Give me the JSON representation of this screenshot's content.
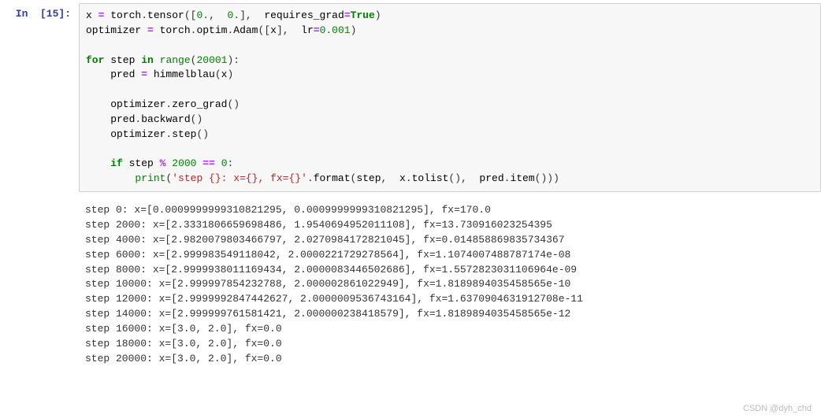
{
  "cell": {
    "prompt": "In  [15]:",
    "code_tokens": [
      {
        "t": "x ",
        "c": "nm"
      },
      {
        "t": "=",
        "c": "op"
      },
      {
        "t": " torch",
        "c": "nm"
      },
      {
        "t": ".",
        "c": "pu"
      },
      {
        "t": "tensor",
        "c": "nm"
      },
      {
        "t": "(",
        "c": "pu"
      },
      {
        "t": "[",
        "c": "pu"
      },
      {
        "t": "0.",
        "c": "num"
      },
      {
        "t": ", ",
        "c": "pu"
      },
      {
        "t": " 0.",
        "c": "num"
      },
      {
        "t": "]",
        "c": "pu"
      },
      {
        "t": ", ",
        "c": "pu"
      },
      {
        "t": " requires_grad",
        "c": "nm"
      },
      {
        "t": "=",
        "c": "op"
      },
      {
        "t": "True",
        "c": "kw"
      },
      {
        "t": ")",
        "c": "pu"
      },
      {
        "t": "\n",
        "c": "pu"
      },
      {
        "t": "optimizer ",
        "c": "nm"
      },
      {
        "t": "=",
        "c": "op"
      },
      {
        "t": " torch",
        "c": "nm"
      },
      {
        "t": ".",
        "c": "pu"
      },
      {
        "t": "optim",
        "c": "nm"
      },
      {
        "t": ".",
        "c": "pu"
      },
      {
        "t": "Adam",
        "c": "nm"
      },
      {
        "t": "(",
        "c": "pu"
      },
      {
        "t": "[",
        "c": "pu"
      },
      {
        "t": "x",
        "c": "nm"
      },
      {
        "t": "]",
        "c": "pu"
      },
      {
        "t": ", ",
        "c": "pu"
      },
      {
        "t": " lr",
        "c": "nm"
      },
      {
        "t": "=",
        "c": "op"
      },
      {
        "t": "0.001",
        "c": "num"
      },
      {
        "t": ")",
        "c": "pu"
      },
      {
        "t": "\n",
        "c": "pu"
      },
      {
        "t": "\n",
        "c": "pu"
      },
      {
        "t": "for",
        "c": "kw"
      },
      {
        "t": " step ",
        "c": "nm"
      },
      {
        "t": "in",
        "c": "kw"
      },
      {
        "t": " ",
        "c": "pu"
      },
      {
        "t": "range",
        "c": "bi"
      },
      {
        "t": "(",
        "c": "pu"
      },
      {
        "t": "20001",
        "c": "num"
      },
      {
        "t": ")",
        "c": "pu"
      },
      {
        "t": ":",
        "c": "pu"
      },
      {
        "t": "\n",
        "c": "pu"
      },
      {
        "t": "    pred ",
        "c": "nm"
      },
      {
        "t": "=",
        "c": "op"
      },
      {
        "t": " himmelblau",
        "c": "nm"
      },
      {
        "t": "(",
        "c": "pu"
      },
      {
        "t": "x",
        "c": "nm"
      },
      {
        "t": ")",
        "c": "pu"
      },
      {
        "t": "\n",
        "c": "pu"
      },
      {
        "t": "\n",
        "c": "pu"
      },
      {
        "t": "    optimizer",
        "c": "nm"
      },
      {
        "t": ".",
        "c": "pu"
      },
      {
        "t": "zero_grad",
        "c": "nm"
      },
      {
        "t": "()",
        "c": "pu"
      },
      {
        "t": "\n",
        "c": "pu"
      },
      {
        "t": "    pred",
        "c": "nm"
      },
      {
        "t": ".",
        "c": "pu"
      },
      {
        "t": "backward",
        "c": "nm"
      },
      {
        "t": "()",
        "c": "pu"
      },
      {
        "t": "\n",
        "c": "pu"
      },
      {
        "t": "    optimizer",
        "c": "nm"
      },
      {
        "t": ".",
        "c": "pu"
      },
      {
        "t": "step",
        "c": "nm"
      },
      {
        "t": "()",
        "c": "pu"
      },
      {
        "t": "\n",
        "c": "pu"
      },
      {
        "t": "\n",
        "c": "pu"
      },
      {
        "t": "    ",
        "c": "pu"
      },
      {
        "t": "if",
        "c": "kw"
      },
      {
        "t": " step ",
        "c": "nm"
      },
      {
        "t": "%",
        "c": "op"
      },
      {
        "t": " ",
        "c": "pu"
      },
      {
        "t": "2000",
        "c": "num"
      },
      {
        "t": " ",
        "c": "pu"
      },
      {
        "t": "==",
        "c": "op"
      },
      {
        "t": " ",
        "c": "pu"
      },
      {
        "t": "0",
        "c": "num"
      },
      {
        "t": ":",
        "c": "pu"
      },
      {
        "t": "\n",
        "c": "pu"
      },
      {
        "t": "        ",
        "c": "pu"
      },
      {
        "t": "print",
        "c": "bi"
      },
      {
        "t": "(",
        "c": "pu"
      },
      {
        "t": "'step {}: x={}, fx={}'",
        "c": "str"
      },
      {
        "t": ".",
        "c": "pu"
      },
      {
        "t": "format",
        "c": "nm"
      },
      {
        "t": "(",
        "c": "pu"
      },
      {
        "t": "step",
        "c": "nm"
      },
      {
        "t": ", ",
        "c": "pu"
      },
      {
        "t": " x",
        "c": "nm"
      },
      {
        "t": ".",
        "c": "pu"
      },
      {
        "t": "tolist",
        "c": "nm"
      },
      {
        "t": "()",
        "c": "pu"
      },
      {
        "t": ", ",
        "c": "pu"
      },
      {
        "t": " pred",
        "c": "nm"
      },
      {
        "t": ".",
        "c": "pu"
      },
      {
        "t": "item",
        "c": "nm"
      },
      {
        "t": "()",
        "c": "pu"
      },
      {
        "t": ")",
        "c": "pu"
      },
      {
        "t": ")",
        "c": "pu"
      }
    ],
    "output_lines": [
      "step 0: x=[0.0009999999310821295, 0.0009999999310821295], fx=170.0",
      "step 2000: x=[2.3331806659698486, 1.9540694952011108], fx=13.730916023254395",
      "step 4000: x=[2.9820079803466797, 2.0270984172821045], fx=0.014858869835734367",
      "step 6000: x=[2.999983549118042, 2.0000221729278564], fx=1.1074007488787174e-08",
      "step 8000: x=[2.9999938011169434, 2.0000083446502686], fx=1.5572823031106964e-09",
      "step 10000: x=[2.999997854232788, 2.000002861022949], fx=1.8189894035458565e-10",
      "step 12000: x=[2.9999992847442627, 2.0000009536743164], fx=1.6370904631912708e-11",
      "step 14000: x=[2.999999761581421, 2.000000238418579], fx=1.8189894035458565e-12",
      "step 16000: x=[3.0, 2.0], fx=0.0",
      "step 18000: x=[3.0, 2.0], fx=0.0",
      "step 20000: x=[3.0, 2.0], fx=0.0"
    ]
  },
  "watermark": "CSDN @dyh_chd"
}
